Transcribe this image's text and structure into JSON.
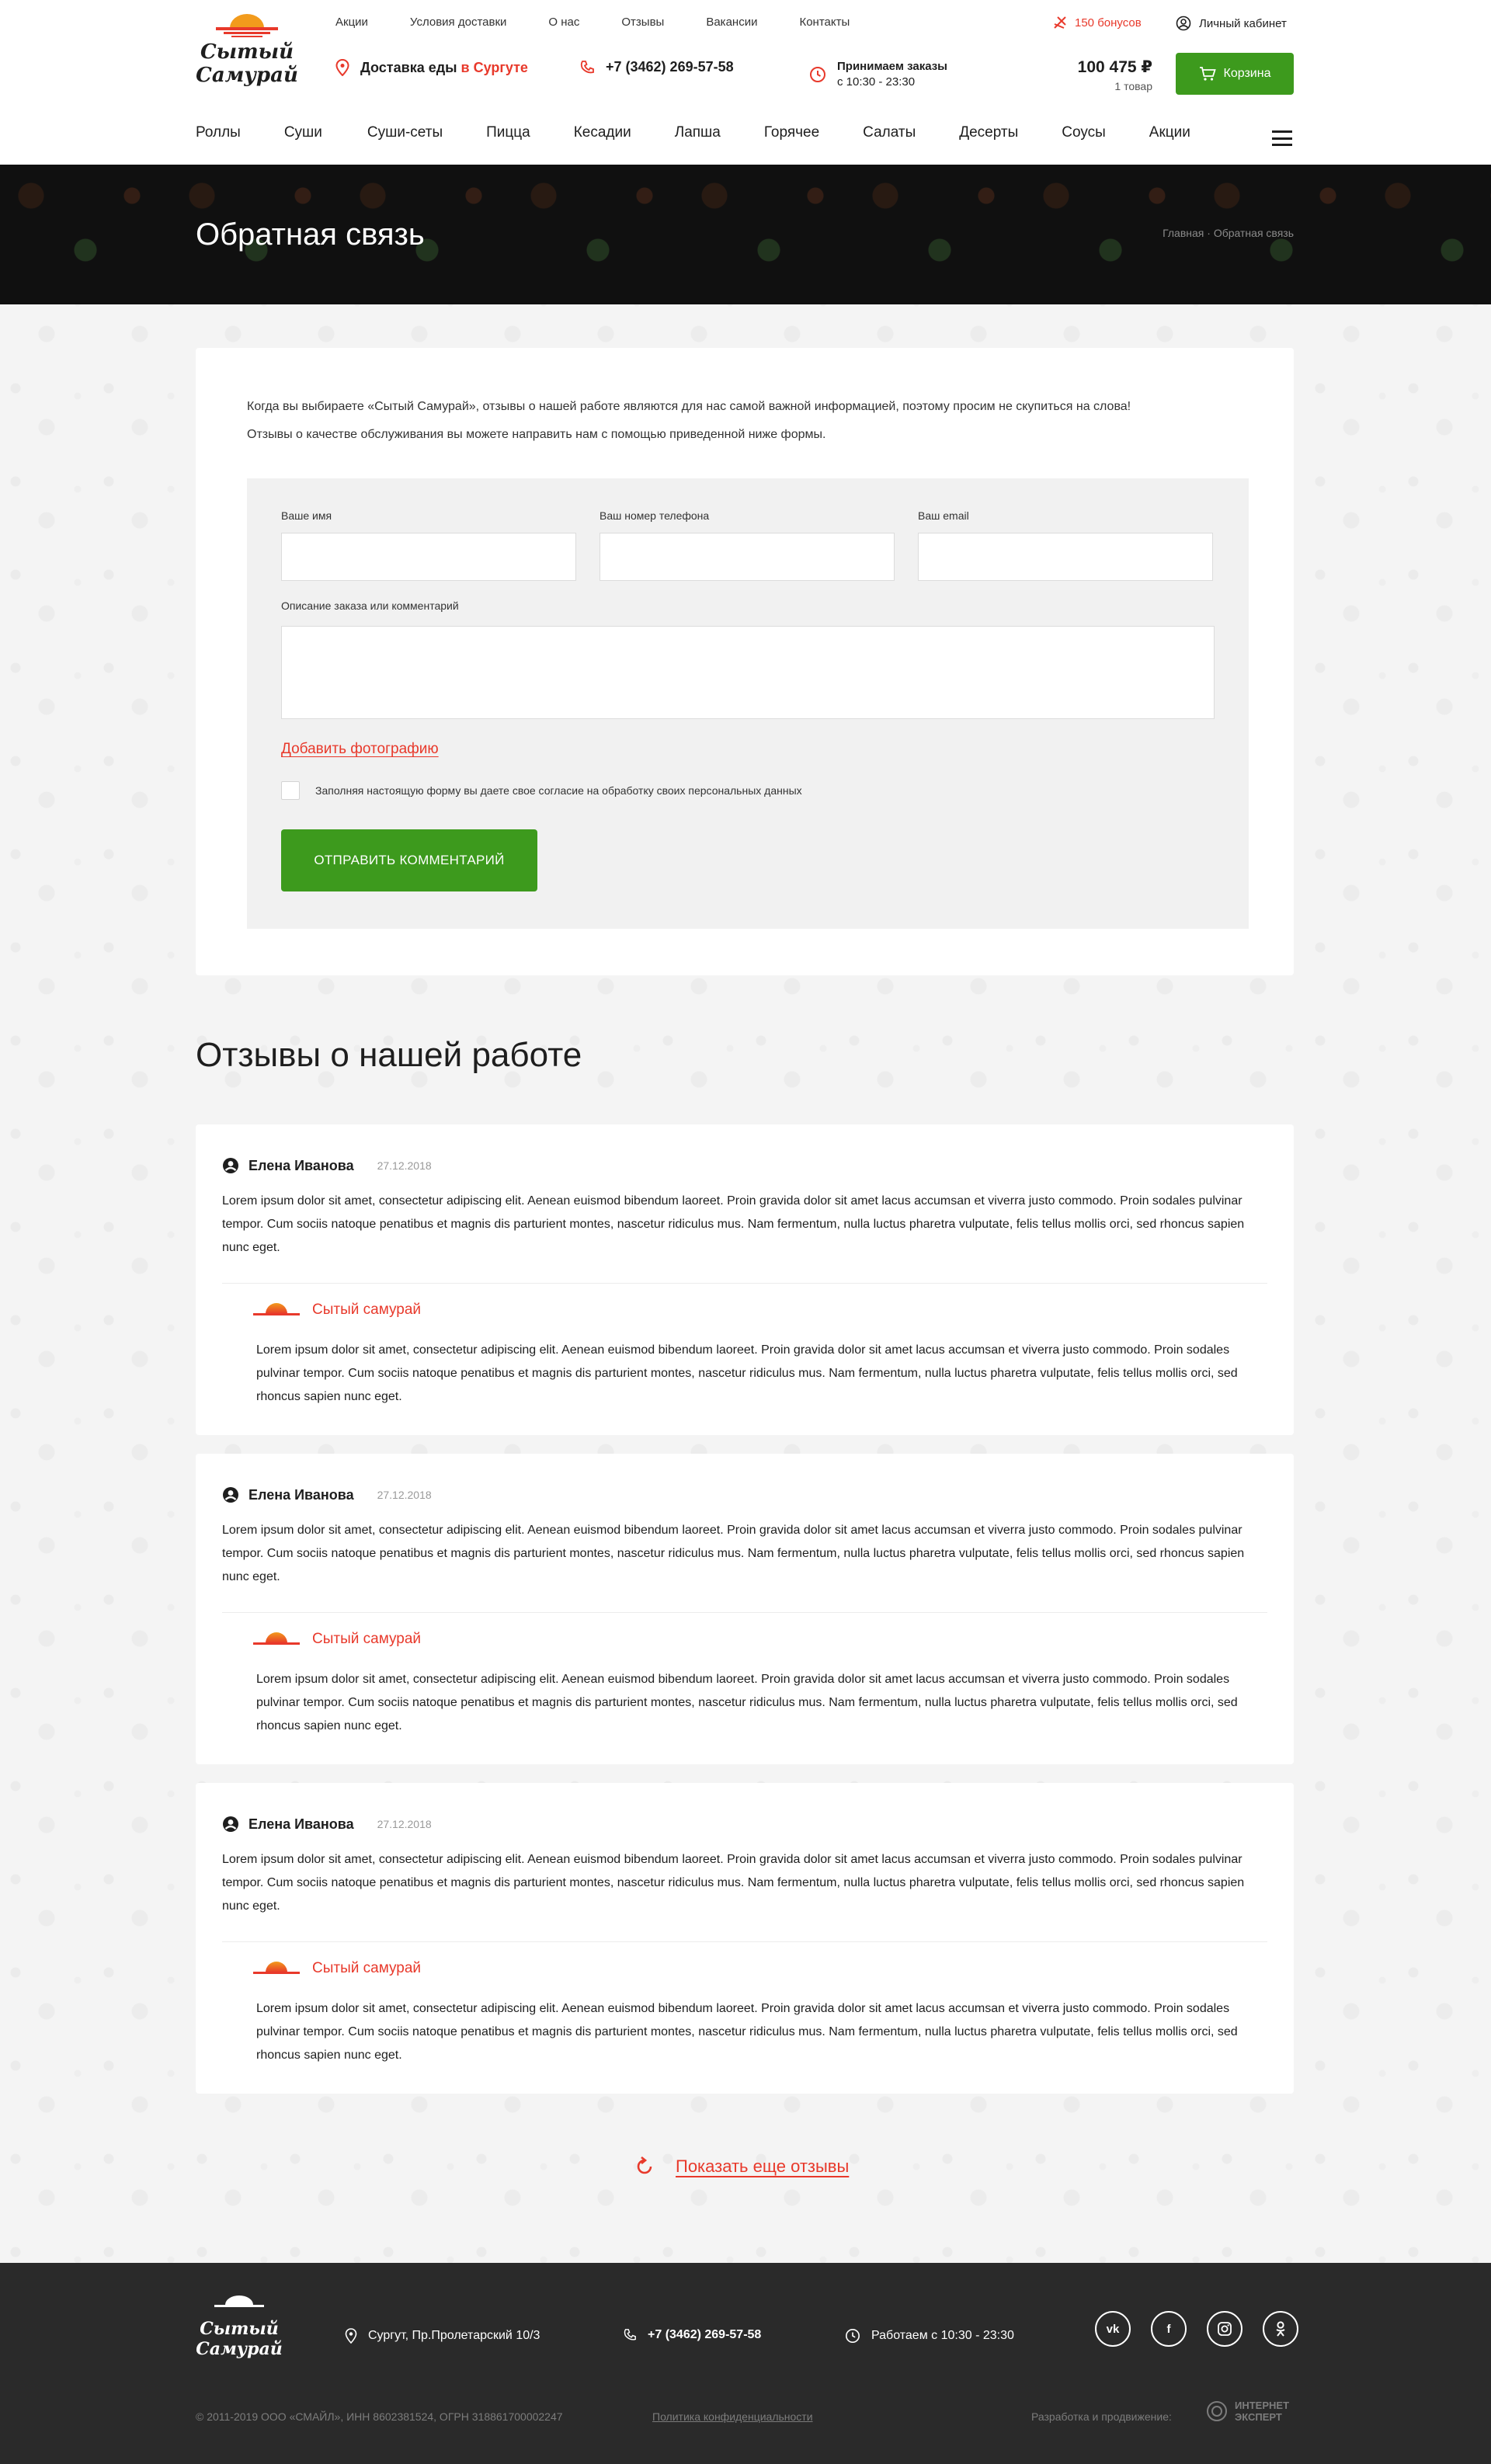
{
  "header": {
    "logo_line1": "Сытый",
    "logo_line2": "Самурай",
    "top_links": [
      "Акции",
      "Условия доставки",
      "О нас",
      "Отзывы",
      "Вакансии",
      "Контакты"
    ],
    "bonus": "150 бонусов",
    "cabinet": "Личный кабинет",
    "delivery_prefix": "Доставка еды ",
    "delivery_city": "в Сургуте",
    "phone": "+7 (3462) 269-57-58",
    "hours_line1": "Принимаем заказы",
    "hours_line2": "с 10:30 - 23:30",
    "cart_total": "100 475 ₽",
    "cart_count": "1 товар",
    "cart_button": "Корзина",
    "categories": [
      "Роллы",
      "Суши",
      "Суши-сеты",
      "Пицца",
      "Кесадии",
      "Лапша",
      "Горячее",
      "Салаты",
      "Десерты",
      "Соусы",
      "Акции"
    ]
  },
  "banner": {
    "title": "Обратная связь",
    "breadcrumb_home": "Главная",
    "breadcrumb_current": "Обратная связь"
  },
  "form": {
    "intro1": "Когда вы выбираете «Сытый Самурай», отзывы о нашей работе являются для нас самой важной информацией, поэтому просим не скупиться на слова!",
    "intro2": "Отзывы о качестве обслуживания вы можете направить нам с помощью приведенной ниже формы.",
    "name_label": "Ваше имя",
    "phone_label": "Ваш номер телефона",
    "email_label": "Ваш email",
    "comment_label": "Описание заказа или комментарий",
    "add_photo": "Добавить фотографию",
    "consent": "Заполняя настоящую форму вы даете свое согласие на обработку своих персональных данных",
    "submit": "Отправить комментарий"
  },
  "reviews_title": "Отзывы о нашей работе",
  "reviews": [
    {
      "author": "Елена Иванова",
      "date": "27.12.2018",
      "text": "Lorem ipsum dolor sit amet, consectetur adipiscing elit. Aenean euismod bibendum laoreet. Proin gravida dolor sit amet lacus accumsan et viverra justo commodo. Proin sodales pulvinar tempor. Cum sociis natoque penatibus et magnis dis parturient montes, nascetur ridiculus mus. Nam fermentum, nulla luctus pharetra vulputate, felis tellus mollis orci, sed rhoncus sapien nunc eget.",
      "answer_author": "Сытый самурай",
      "answer_text": "Lorem ipsum dolor sit amet, consectetur adipiscing elit. Aenean euismod bibendum laoreet. Proin gravida dolor sit amet lacus accumsan et viverra justo commodo. Proin sodales pulvinar tempor. Cum sociis natoque penatibus et magnis dis parturient montes, nascetur ridiculus mus. Nam fermentum, nulla luctus pharetra vulputate, felis tellus mollis orci, sed rhoncus sapien nunc eget."
    },
    {
      "author": "Елена Иванова",
      "date": "27.12.2018",
      "text": "Lorem ipsum dolor sit amet, consectetur adipiscing elit. Aenean euismod bibendum laoreet. Proin gravida dolor sit amet lacus accumsan et viverra justo commodo. Proin sodales pulvinar tempor. Cum sociis natoque penatibus et magnis dis parturient montes, nascetur ridiculus mus. Nam fermentum, nulla luctus pharetra vulputate, felis tellus mollis orci, sed rhoncus sapien nunc eget.",
      "answer_author": "Сытый самурай",
      "answer_text": "Lorem ipsum dolor sit amet, consectetur adipiscing elit. Aenean euismod bibendum laoreet. Proin gravida dolor sit amet lacus accumsan et viverra justo commodo. Proin sodales pulvinar tempor. Cum sociis natoque penatibus et magnis dis parturient montes, nascetur ridiculus mus. Nam fermentum, nulla luctus pharetra vulputate, felis tellus mollis orci, sed rhoncus sapien nunc eget."
    },
    {
      "author": "Елена Иванова",
      "date": "27.12.2018",
      "text": "Lorem ipsum dolor sit amet, consectetur adipiscing elit. Aenean euismod bibendum laoreet. Proin gravida dolor sit amet lacus accumsan et viverra justo commodo. Proin sodales pulvinar tempor. Cum sociis natoque penatibus et magnis dis parturient montes, nascetur ridiculus mus. Nam fermentum, nulla luctus pharetra vulputate, felis tellus mollis orci, sed rhoncus sapien nunc eget.",
      "answer_author": "Сытый самурай",
      "answer_text": "Lorem ipsum dolor sit amet, consectetur adipiscing elit. Aenean euismod bibendum laoreet. Proin gravida dolor sit amet lacus accumsan et viverra justo commodo. Proin sodales pulvinar tempor. Cum sociis natoque penatibus et magnis dis parturient montes, nascetur ridiculus mus. Nam fermentum, nulla luctus pharetra vulputate, felis tellus mollis orci, sed rhoncus sapien nunc eget."
    }
  ],
  "show_more": "Показать еще отзывы",
  "footer": {
    "logo_line1": "Сытый",
    "logo_line2": "Самурай",
    "address": "Сургут, Пр.Пролетарский 10/3",
    "phone": "+7 (3462) 269-57-58",
    "hours": "Работаем с 10:30 - 23:30",
    "social_vk": "vk",
    "social_fb": "f",
    "copyright": "© 2011-2019   ООО «СМАЙЛ», ИНН 8602381524, ОГРН 318861700002247",
    "privacy": "Политика конфиденциальности",
    "developer_label": "Разработка и продвижение:",
    "developer_name": "ИНТЕРНЕТ ЭКСПЕРТ"
  },
  "colors": {
    "accent_red": "#e8392b",
    "accent_green": "#3d9a1d",
    "footer_bg": "#2a2a2a"
  }
}
